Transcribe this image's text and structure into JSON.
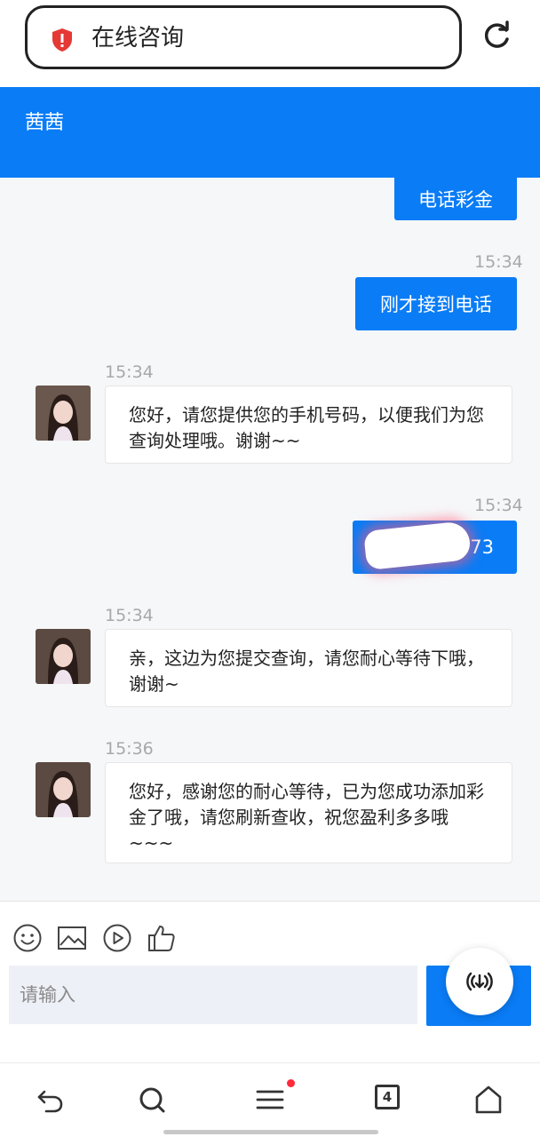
{
  "browser": {
    "address_text": "在线咨询",
    "icons": {
      "security": "shield-alert-icon",
      "reload": "reload-icon"
    }
  },
  "header": {
    "title": "茜茜"
  },
  "messages": [
    {
      "side": "out",
      "text": "电话彩金"
    },
    {
      "side": "out",
      "time": "15:34",
      "text": "刚才接到电话"
    },
    {
      "side": "in",
      "time": "15:34",
      "text": "您好，请您提供您的手机号码，以便我们为您查询处理哦。谢谢~~"
    },
    {
      "side": "out",
      "time": "15:34",
      "text": "73"
    },
    {
      "side": "in",
      "time": "15:34",
      "text": "亲，这边为您提交查询，请您耐心等待下哦，谢谢~"
    },
    {
      "side": "in",
      "time": "15:36",
      "text": "您好，感谢您的耐心等待，已为您成功添加彩金了哦，请您刷新查收，祝您盈利多多哦~~~"
    }
  ],
  "composer": {
    "placeholder": "请输入",
    "tools": [
      "emoji-icon",
      "image-icon",
      "video-icon",
      "thumbs-up-icon"
    ]
  },
  "bottom_nav": {
    "tabs_count": "4",
    "items": [
      "back-icon",
      "search-icon",
      "menu-icon",
      "tabs-icon",
      "home-icon"
    ]
  },
  "colors": {
    "accent": "#0a7cf6",
    "chat_bg": "#f6f7f9"
  }
}
